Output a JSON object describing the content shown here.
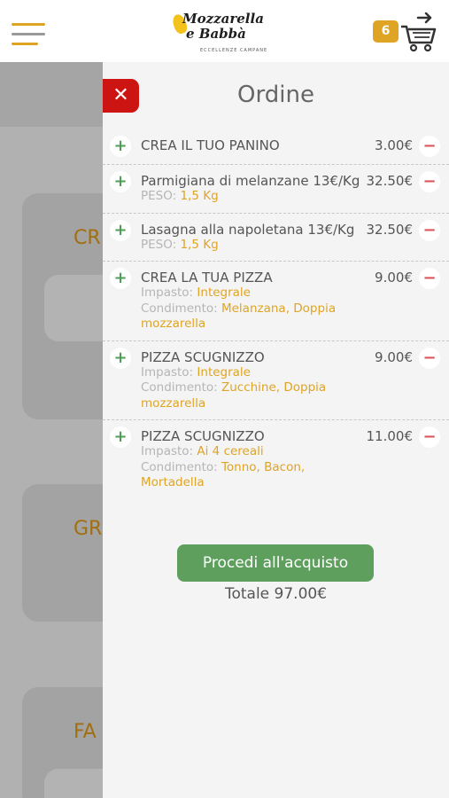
{
  "header": {
    "logo": {
      "line1": "Mozzarella",
      "line2": "e Babbà",
      "tagline": "ECCELLENZE CAMPANE"
    },
    "cart_count": "6"
  },
  "background": {
    "categories": [
      "CR",
      "GR",
      "FA"
    ]
  },
  "panel": {
    "close_symbol": "✕",
    "title": "Ordine",
    "plus_symbol": "+",
    "minus_symbol": "−",
    "orders": [
      {
        "name": "CREA IL TUO PANINO",
        "price": "3.00€",
        "details": []
      },
      {
        "name": "Parmigiana di melanzane 13€/Kg",
        "price": "32.50€",
        "details": [
          {
            "key": "PESO: ",
            "value": "1,5 Kg"
          }
        ]
      },
      {
        "name": "Lasagna alla napoletana 13€/Kg",
        "price": "32.50€",
        "details": [
          {
            "key": "PESO: ",
            "value": "1,5 Kg"
          }
        ]
      },
      {
        "name": "CREA LA TUA PIZZA",
        "price": "9.00€",
        "details": [
          {
            "key": "Impasto: ",
            "value": "Integrale"
          },
          {
            "key": "Condimento: ",
            "value": "Melanzana, Doppia mozzarella"
          }
        ]
      },
      {
        "name": "PIZZA SCUGNIZZO",
        "price": "9.00€",
        "details": [
          {
            "key": "Impasto: ",
            "value": "Integrale"
          },
          {
            "key": "Condimento: ",
            "value": "Zucchine, Doppia mozzarella"
          }
        ]
      },
      {
        "name": "PIZZA SCUGNIZZO",
        "price": "11.00€",
        "details": [
          {
            "key": "Impasto: ",
            "value": "Ai 4 cereali"
          },
          {
            "key": "Condimento: ",
            "value": "Tonno, Bacon, Mortadella"
          }
        ]
      }
    ],
    "checkout_label": "Procedi all'acquisto",
    "total": "Totale 97.00€"
  },
  "colors": {
    "accent": "#e0a424",
    "close": "#cc1412",
    "checkout": "#5e9f5e",
    "plus": "#4f9e57",
    "minus": "#d9545b"
  }
}
